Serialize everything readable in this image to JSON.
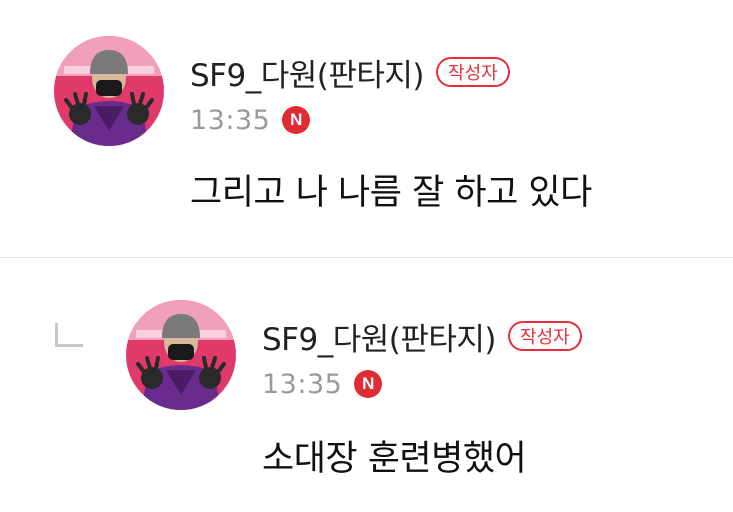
{
  "comments": [
    {
      "author": "SF9_다원(판타지)",
      "badge": "작성자",
      "time": "13:35",
      "new_label": "N",
      "text": "그리고 나 나름 잘 하고 있다",
      "is_reply": false
    },
    {
      "author": "SF9_다원(판타지)",
      "badge": "작성자",
      "time": "13:35",
      "new_label": "N",
      "text": "소대장 훈련병했어",
      "is_reply": true
    }
  ],
  "colors": {
    "badge_red": "#e4303c",
    "new_icon_red": "#e02a34",
    "time_gray": "#9a9a9a",
    "divider": "#e6e6e6"
  },
  "icons": {
    "new": "new-badge-icon",
    "reply": "reply-arrow-icon",
    "avatar": "profile-avatar"
  }
}
